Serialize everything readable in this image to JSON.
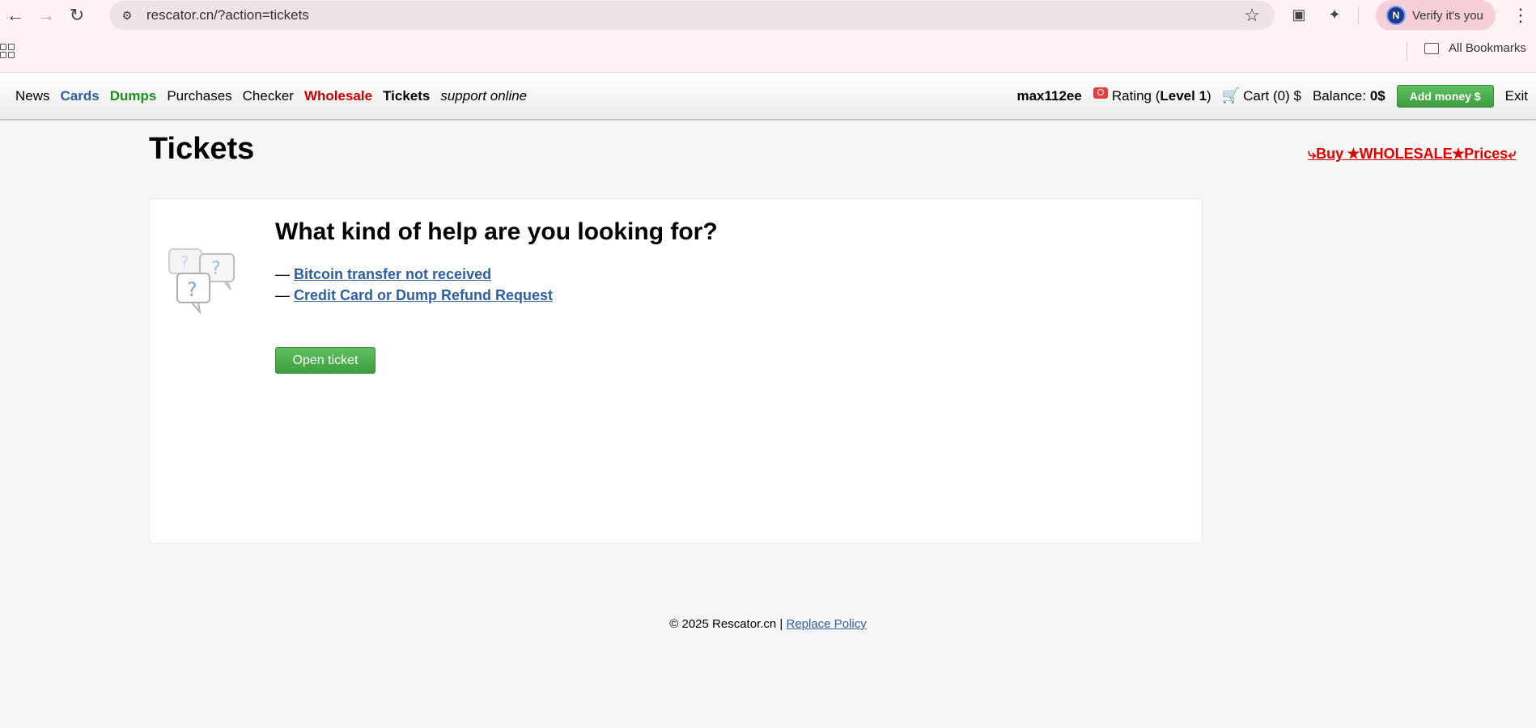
{
  "browser": {
    "url": "rescator.cn/?action=tickets",
    "profile_initial": "N",
    "profile_label": "Verify it's you",
    "bookmarks_label": "All Bookmarks"
  },
  "nav": {
    "items": [
      {
        "label": "News"
      },
      {
        "label": "Cards"
      },
      {
        "label": "Dumps"
      },
      {
        "label": "Purchases"
      },
      {
        "label": "Checker"
      },
      {
        "label": "Wholesale"
      },
      {
        "label": "Tickets"
      },
      {
        "label": "support online"
      }
    ],
    "username": "max112ee",
    "rating_prefix": "Rating (",
    "rating_level": "Level 1",
    "rating_suffix": ")",
    "cart": "Cart (0) $",
    "balance_label": "Balance: ",
    "balance_value": "0$",
    "add_money": "Add money $",
    "exit": "Exit"
  },
  "page": {
    "title": "Tickets",
    "promo": "⤷Buy ★WHOLESALE★Prices⤶",
    "help_title": "What kind of help are you looking for?",
    "dash": "—",
    "options": [
      {
        "label": "Bitcoin transfer not received"
      },
      {
        "label": "Credit Card or Dump Refund Request"
      }
    ],
    "open_ticket": "Open ticket"
  },
  "footer": {
    "copyright": "© 2025 Rescator.cn | ",
    "policy_link": "Replace Policy"
  },
  "colors": {
    "link_blue": "#2f5f9e",
    "dumps_green": "#1a8f1a",
    "wholesale_red": "#cc0000",
    "button_green": "#4caf50",
    "promo_red": "#e00000"
  }
}
